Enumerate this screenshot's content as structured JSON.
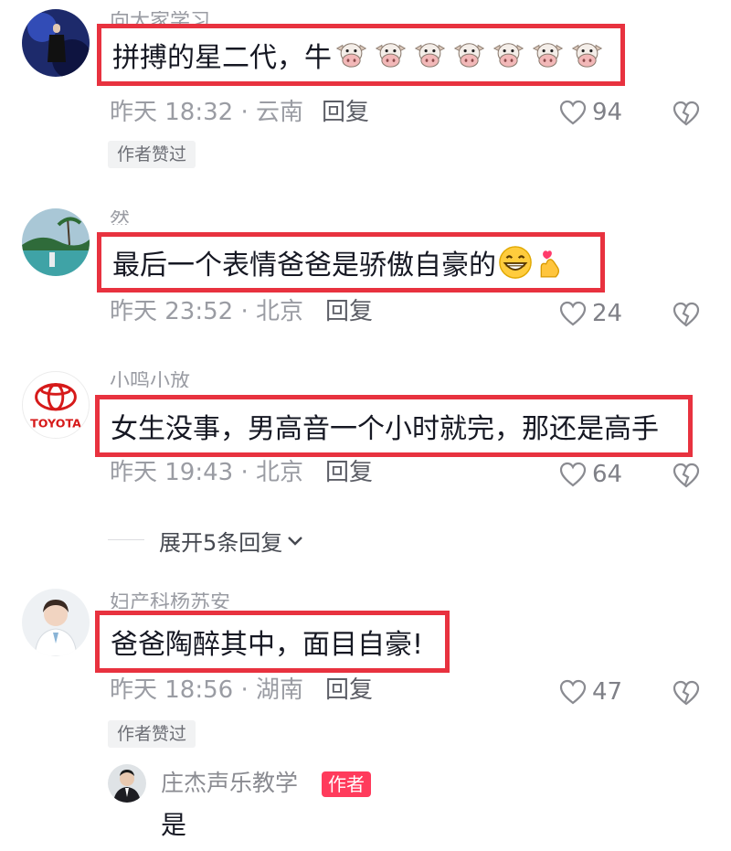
{
  "comments": [
    {
      "username": "向大家学习",
      "text": "拼搏的星二代，牛",
      "emoji_count": 7,
      "time": "昨天 18:32 · 云南",
      "reply": "回复",
      "likes": "94",
      "badge": "作者赞过"
    },
    {
      "username": "然",
      "text": "最后一个表情爸爸是骄傲自豪的",
      "time": "昨天 23:52 · 北京",
      "reply": "回复",
      "likes": "24"
    },
    {
      "username": "小鸣小放",
      "text": "女生没事，男高音一个小时就完，那还是高手",
      "time": "昨天 19:43 · 北京",
      "reply": "回复",
      "likes": "64",
      "avatar_text": "TOYOTA"
    },
    {
      "username": "妇产科杨苏安",
      "text": "爸爸陶醉其中，面目自豪!",
      "time": "昨天 18:56 · 湖南",
      "reply": "回复",
      "likes": "47",
      "badge": "作者赞过"
    }
  ],
  "expand_replies": "展开5条回复",
  "author_reply": {
    "username": "庄杰声乐教学",
    "tag": "作者",
    "text": "是"
  },
  "icons": [
    "heart-icon",
    "broken-heart-icon",
    "cow-face-emoji",
    "grin-emoji",
    "finger-heart-emoji",
    "chevron-down-icon"
  ],
  "colors": {
    "highlight_border": "#e8323f",
    "author_tag": "#ff3b5c",
    "meta_text": "#9a9ca3"
  }
}
